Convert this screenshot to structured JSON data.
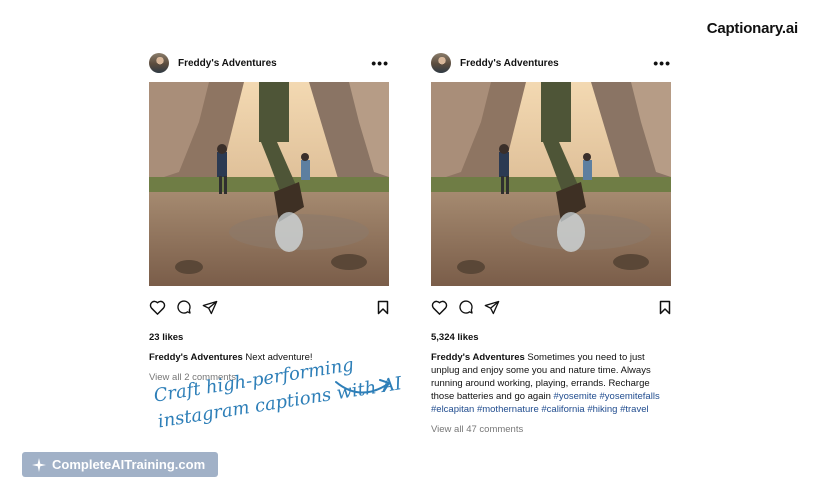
{
  "brand": "Captionary.ai",
  "posts": [
    {
      "username": "Freddy's Adventures",
      "likes": "23 likes",
      "caption_user": "Freddy's Adventures",
      "caption_text": "Next adventure!",
      "view_comments": "View all 2 comments"
    },
    {
      "username": "Freddy's Adventures",
      "likes": "5,324 likes",
      "caption_user": "Freddy's Adventures",
      "caption_text": "Sometimes you need to just unplug and enjoy some you and nature time. Always running around working, playing, errands. Recharge those batteries and go again",
      "hashtags": [
        "#yosemite",
        "#yosemitefalls",
        "#elcapitan",
        "#mothernature",
        "#california",
        "#hiking",
        "#travel"
      ],
      "view_comments": "View all 47 comments"
    }
  ],
  "tagline": {
    "line1": "Craft high-performing",
    "line2": "instagram captions with AI"
  },
  "watermark": "CompleteAITraining.com",
  "colors": {
    "hashtag": "#214d8f",
    "tagline": "#2e7fb8",
    "watermark_bg": "#9cadc5"
  }
}
